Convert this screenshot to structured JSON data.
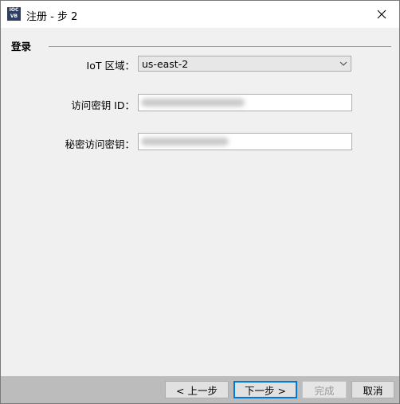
{
  "window": {
    "title": "注册 - 步 2",
    "icon_text": [
      "IOC",
      "VB"
    ],
    "icon": "app-logo-icon",
    "close_icon": "close-icon"
  },
  "login_group": {
    "title": "登录",
    "iot_region_label": "IoT 区域：",
    "iot_region_value": "us-east-2",
    "access_key_id_label": "访问密钥 ID：",
    "access_key_id_value": "",
    "secret_key_label": "秘密访问密钥：",
    "secret_key_value": ""
  },
  "buttons": {
    "back": "< 上一步",
    "next": "下一步 >",
    "finish": "完成",
    "cancel": "取消"
  },
  "colors": {
    "footer_bg": "#bcbcbc",
    "content_bg": "#f0f0f0",
    "default_button_border": "#0078d7"
  }
}
